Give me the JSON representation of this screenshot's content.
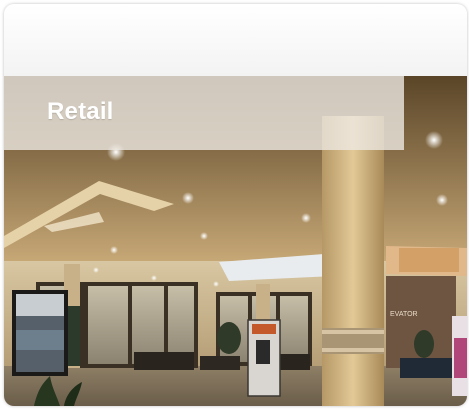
{
  "tile": {
    "label": "Retail"
  },
  "sign": {
    "elevator_text": "EVATOR"
  },
  "colors": {
    "label_text": "#ffffff",
    "label_band": "#eee8e2",
    "card_background": "#f4f4f4"
  }
}
